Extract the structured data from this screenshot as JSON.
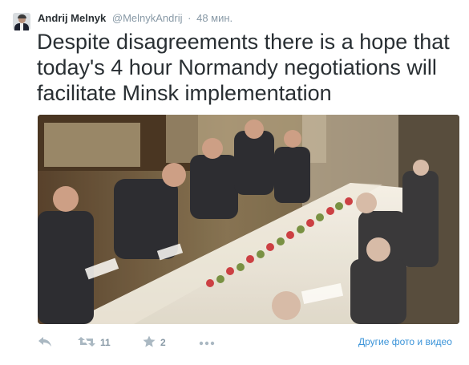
{
  "tweet": {
    "author": {
      "fullname": "Andrij Melnyk",
      "username": "@MelnykAndrij",
      "separator": "·",
      "time": "48 мин."
    },
    "text": "Despite disagreements there is a hope that today's 4 hour Normandy negotiations will facilitate Minsk implementation",
    "actions": {
      "retweet_count": "11",
      "favorite_count": "2",
      "media_link": "Другие фото и видео"
    },
    "icons": {
      "reply": "reply-icon",
      "retweet": "retweet-icon",
      "favorite": "star-icon",
      "more": "more-icon"
    },
    "colors": {
      "text": "#292f33",
      "muted": "#8899a6",
      "link": "#3b94d9"
    }
  }
}
